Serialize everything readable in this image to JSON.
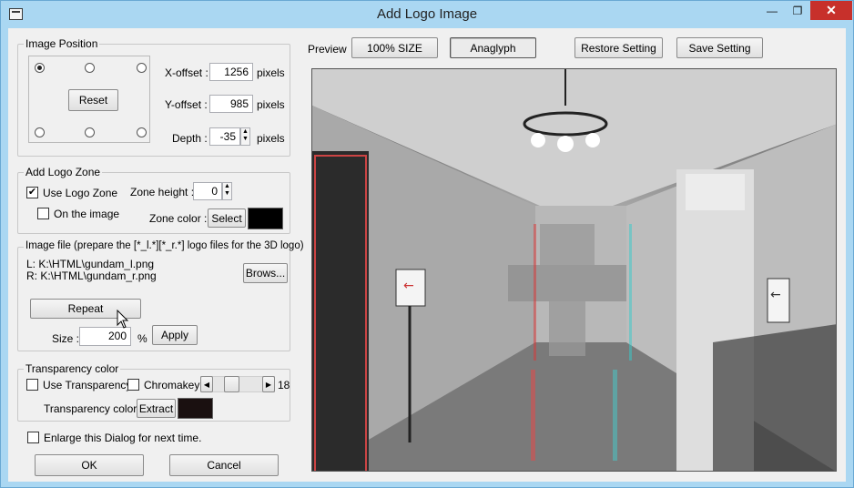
{
  "window": {
    "title": "Add Logo Image",
    "minimize_glyph": "—",
    "maximize_glyph": "❐",
    "close_glyph": "✕"
  },
  "image_position": {
    "group_label": "Image Position",
    "reset_label": "Reset",
    "x_offset_label": "X-offset :",
    "x_offset_value": "1256",
    "y_offset_label": "Y-offset :",
    "y_offset_value": "985",
    "depth_label": "Depth :",
    "depth_value": "-35",
    "unit": "pixels"
  },
  "logo_zone": {
    "group_label": "Add Logo Zone",
    "use_logo_zone_label": "Use Logo Zone",
    "use_logo_zone_checked": true,
    "on_image_label": "On the image",
    "on_image_checked": false,
    "zone_height_label": "Zone height :",
    "zone_height_value": "0",
    "zone_color_label": "Zone color :",
    "select_label": "Select",
    "zone_color": "#000000"
  },
  "image_file": {
    "group_label": "Image file (prepare the [*_l.*][*_r.*] logo files for the 3D logo)",
    "left_path": "L: K:\\HTML\\gundam_l.png",
    "right_path": "R: K:\\HTML\\gundam_r.png",
    "browse_label": "Brows...",
    "repeat_label": "Repeat",
    "size_label": "Size :",
    "size_value": "200",
    "size_unit": "%",
    "apply_label": "Apply"
  },
  "transparency": {
    "group_label": "Transparency color",
    "use_transparency_label": "Use Transparency",
    "chromakey_label": "Chromakey",
    "slider_value": "18",
    "color_label": "Transparency color :",
    "extract_label": "Extract",
    "color": "#1a1010"
  },
  "enlarge_label": "Enlarge this Dialog for next time.",
  "ok_label": "OK",
  "cancel_label": "Cancel",
  "toolbar": {
    "preview_label": "Preview",
    "size100_label": "100% SIZE",
    "anaglyph_label": "Anaglyph",
    "restore_label": "Restore Setting",
    "save_label": "Save Setting"
  },
  "colors": {
    "titlebar": "#aad7f2",
    "close": "#c7302b",
    "dialog_bg": "#f0f0f0"
  }
}
